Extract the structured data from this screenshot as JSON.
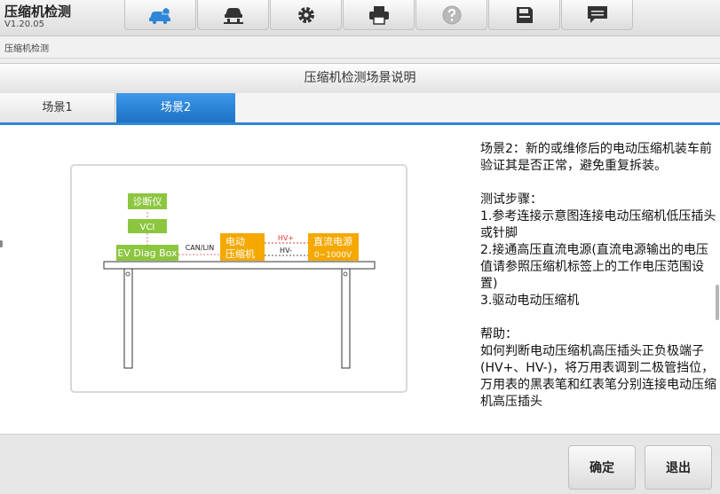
{
  "app": {
    "title": "压缩机检测",
    "version": "V1.20.05"
  },
  "breadcrumb": "压缩机检测",
  "page_title": "压缩机检测场景说明",
  "tabs": [
    {
      "label": "场景1",
      "active": false
    },
    {
      "label": "场景2",
      "active": true
    }
  ],
  "diagram": {
    "diag_tool": "诊断仪",
    "vci": "VCI",
    "ev_box": "EV Diag Box",
    "can_lin": "CAN/LIN",
    "compressor_line1": "电动",
    "compressor_line2": "压缩机",
    "hv_plus": "HV+",
    "hv_minus": "HV-",
    "dc_line1": "直流电源",
    "dc_line2": "0~1000V"
  },
  "description": "场景2：新的或维修后的电动压缩机装车前验证其是否正常，避免重复拆装。\n\n测试步骤：\n1.参考连接示意图连接电动压缩机低压插头或针脚\n2.接通高压直流电源(直流电源输出的电压值请参照压缩机标签上的工作电压范围设置)\n3.驱动电动压缩机\n\n帮助：\n如何判断电动压缩机高压插头正负极端子(HV+、HV-)，将万用表调到二极管挡位，万用表的黑表笔和红表笔分别连接电动压缩机高压插头",
  "buttons": {
    "confirm": "确定",
    "exit": "退出"
  },
  "colors": {
    "accent": "#2f86d6",
    "green_box": "#8cc63f",
    "orange_box": "#f5a800",
    "hv_red": "#e53935"
  }
}
